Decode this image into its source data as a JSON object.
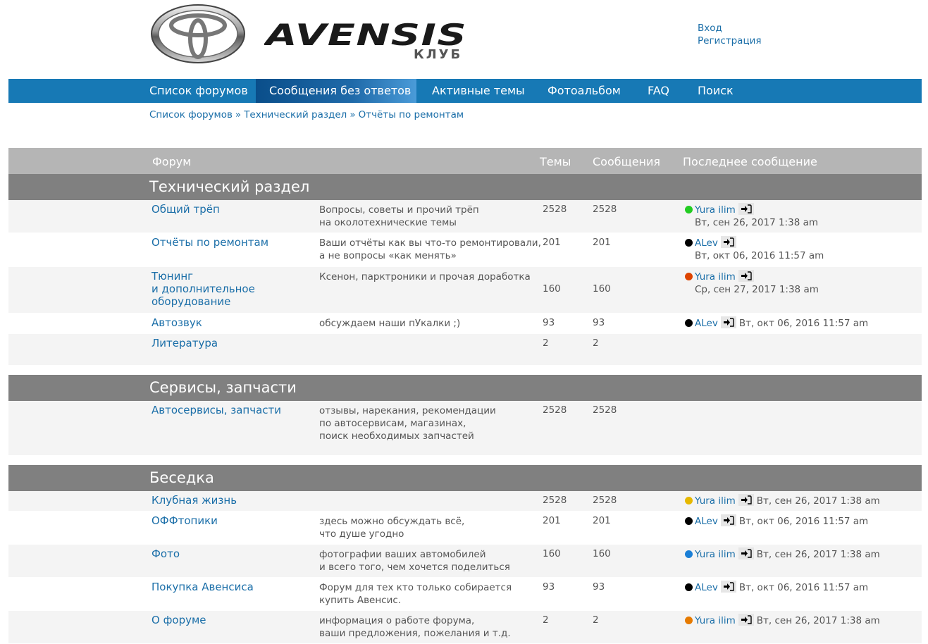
{
  "header": {
    "logo_text": "AVENSIS",
    "logo_sub": "КЛУБ",
    "login": "Вход",
    "register": "Регистрация"
  },
  "nav": [
    "Список форумов",
    "Сообщения без ответов",
    "Активные темы",
    "Фотоальбом",
    "FAQ",
    "Поиск"
  ],
  "breadcrumb": [
    "Список форумов",
    "Технический раздел",
    "Отчёты по ремонтам"
  ],
  "breadcrumb_sep": "»",
  "table_header": {
    "forum": "Форум",
    "topics": "Темы",
    "posts": "Сообщения",
    "last": "Последнее сообщение"
  },
  "categories": [
    {
      "title": "Технический раздел",
      "forums": [
        {
          "name": [
            "Общий трёп"
          ],
          "desc": [
            "Вопросы, советы и прочий трёп",
            "на околотехнические темы"
          ],
          "topics": "2528",
          "posts": "2528",
          "last_user": "Yura ilim",
          "dot": "#22cc22",
          "last_date": "Вт, сен 26, 2017 1:38 am",
          "date_inline": false
        },
        {
          "name": [
            "Отчёты по ремонтам"
          ],
          "desc": [
            "Ваши отчёты как вы что-то ремонтировали,",
            "а не вопросы «как менять»"
          ],
          "topics": "201",
          "posts": "201",
          "last_user": "ALev",
          "dot": "#000000",
          "last_date": "Вт, окт 06, 2016 11:57 am",
          "date_inline": false
        },
        {
          "name": [
            "Тюнинг",
            "и дополнительное",
            "оборудование"
          ],
          "desc": [
            "Ксенон, парктроники и прочая доработка"
          ],
          "topics": "160",
          "posts": "160",
          "last_user": "Yura ilim",
          "dot": "#dd4400",
          "last_date": "Ср, сен 27, 2017 1:38 am",
          "date_inline": false
        },
        {
          "name": [
            "Автозвук"
          ],
          "desc": [
            "обсуждаем наши пУкалки ;)"
          ],
          "topics": "93",
          "posts": "93",
          "last_user": "ALev",
          "dot": "#000000",
          "last_date": "Вт, окт 06, 2016 11:57 am",
          "date_inline": true
        },
        {
          "name": [
            "Литература"
          ],
          "desc": [],
          "topics": "2",
          "posts": "2",
          "last_user": "",
          "dot": "",
          "last_date": "",
          "date_inline": true
        }
      ]
    },
    {
      "title": "Сервисы, запчасти",
      "forums": [
        {
          "name": [
            "Автосервисы, запчасти"
          ],
          "desc": [
            "отзывы, нарекания, рекомендации",
            "по автосервисам, магазинах,",
            "поиск необходимых запчастей"
          ],
          "topics": "2528",
          "posts": "2528",
          "last_user": "",
          "dot": "",
          "last_date": "",
          "date_inline": true
        }
      ]
    },
    {
      "title": "Беседка",
      "forums": [
        {
          "name": [
            "Клубная жизнь"
          ],
          "desc": [],
          "topics": "2528",
          "posts": "2528",
          "last_user": "Yura ilim",
          "dot": "#e6b800",
          "last_date": "Вт, сен 26, 2017 1:38 am",
          "date_inline": true
        },
        {
          "name": [
            "ОФФтопики"
          ],
          "desc": [
            "здесь можно обсуждать всё,",
            "что душе угодно"
          ],
          "topics": "201",
          "posts": "201",
          "last_user": "ALev",
          "dot": "#000000",
          "last_date": "Вт, окт 06, 2016 11:57 am",
          "date_inline": true
        },
        {
          "name": [
            "Фото"
          ],
          "desc": [
            "фотографии ваших автомобилей",
            "и всего того, чем хочется поделиться"
          ],
          "topics": "160",
          "posts": "160",
          "last_user": "Yura ilim",
          "dot": "#1a7fd6",
          "last_date": "Вт, сен 26, 2017 1:38 am",
          "date_inline": true
        },
        {
          "name": [
            "Покупка Авенсиса"
          ],
          "desc": [
            "Форум для тех кто только собирается",
            "купить Авенсис."
          ],
          "topics": "93",
          "posts": "93",
          "last_user": "ALev",
          "dot": "#000000",
          "last_date": "Вт, окт 06, 2016 11:57 am",
          "date_inline": true
        },
        {
          "name": [
            "О форуме"
          ],
          "desc": [
            "информация о работе форума,",
            "ваши предложения, пожелания и т.д."
          ],
          "topics": "2",
          "posts": "2",
          "last_user": "Yura ilim",
          "dot": "#e67a00",
          "last_date": "Вт, сен 26, 2017 1:38 am",
          "date_inline": true
        }
      ]
    }
  ]
}
